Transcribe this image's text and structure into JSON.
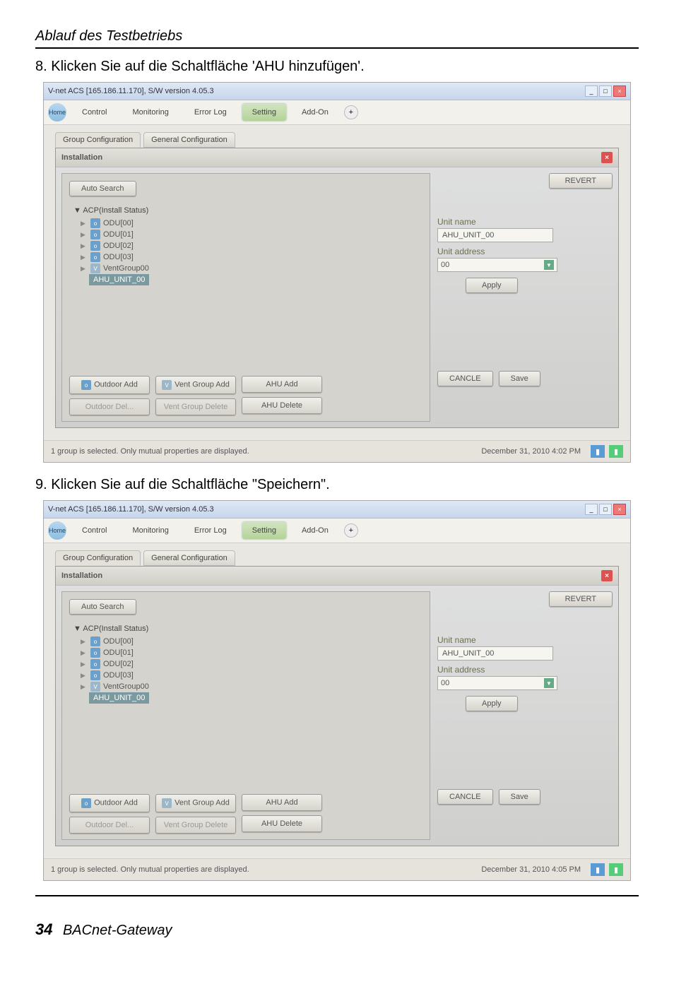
{
  "doc": {
    "header": "Ablauf des Testbetriebs",
    "step8": "8. Klicken Sie auf die Schaltfläche 'AHU hinzufügen'.",
    "step9": "9. Klicken Sie auf die Schaltfläche \"Speichern\".",
    "page_num": "34",
    "book": "BACnet-Gateway"
  },
  "win1": {
    "title": "V-net ACS [165.186.11.170],   S/W version 4.05.3",
    "nav": {
      "home": "Home",
      "control": "Control",
      "monitoring": "Monitoring",
      "errorlog": "Error Log",
      "setting": "Setting",
      "addon": "Add-On"
    },
    "tabs": {
      "group": "Group Configuration",
      "general": "General Configuration"
    },
    "panel_title": "Installation",
    "auto_search": "Auto Search",
    "revert": "REVERT",
    "tree_root": "ACP(Install Status)",
    "tree": {
      "n0": "ODU[00]",
      "n1": "ODU[01]",
      "n2": "ODU[02]",
      "n3": "ODU[03]",
      "n4": "VentGroup00",
      "sel": "AHU_UNIT_00"
    },
    "unit_name_lbl": "Unit name",
    "unit_name_val": "AHU_UNIT_00",
    "unit_addr_lbl": "Unit address",
    "unit_addr_val": "00",
    "apply": "Apply",
    "btns": {
      "outAdd": "Outdoor Add",
      "outDel": "Outdoor Del...",
      "ventAdd": "Vent Group Add",
      "ventDel": "Vent Group Delete",
      "ahuAdd": "AHU Add",
      "ahuDel": "AHU Delete"
    },
    "cancel": "CANCLE",
    "save": "Save",
    "status_left": "1 group is selected. Only mutual properties are displayed.",
    "status_right": "December 31, 2010  4:02 PM"
  },
  "win2": {
    "title": "V-net ACS [165.186.11.170],   S/W version 4.05.3",
    "nav": {
      "home": "Home",
      "control": "Control",
      "monitoring": "Monitoring",
      "errorlog": "Error Log",
      "setting": "Setting",
      "addon": "Add-On"
    },
    "tabs": {
      "group": "Group Configuration",
      "general": "General Configuration"
    },
    "panel_title": "Installation",
    "auto_search": "Auto Search",
    "revert": "REVERT",
    "tree_root": "ACP(Install Status)",
    "tree": {
      "n0": "ODU[00]",
      "n1": "ODU[01]",
      "n2": "ODU[02]",
      "n3": "ODU[03]",
      "n4": "VentGroup00",
      "sel": "AHU_UNIT_00"
    },
    "unit_name_lbl": "Unit name",
    "unit_name_val": "AHU_UNIT_00",
    "unit_addr_lbl": "Unit address",
    "unit_addr_val": "00",
    "apply": "Apply",
    "btns": {
      "outAdd": "Outdoor Add",
      "outDel": "Outdoor Del...",
      "ventAdd": "Vent Group Add",
      "ventDel": "Vent Group Delete",
      "ahuAdd": "AHU Add",
      "ahuDel": "AHU Delete"
    },
    "cancel": "CANCLE",
    "save": "Save",
    "status_left": "1 group is selected. Only mutual properties are displayed.",
    "status_right": "December 31, 2010  4:05 PM"
  }
}
